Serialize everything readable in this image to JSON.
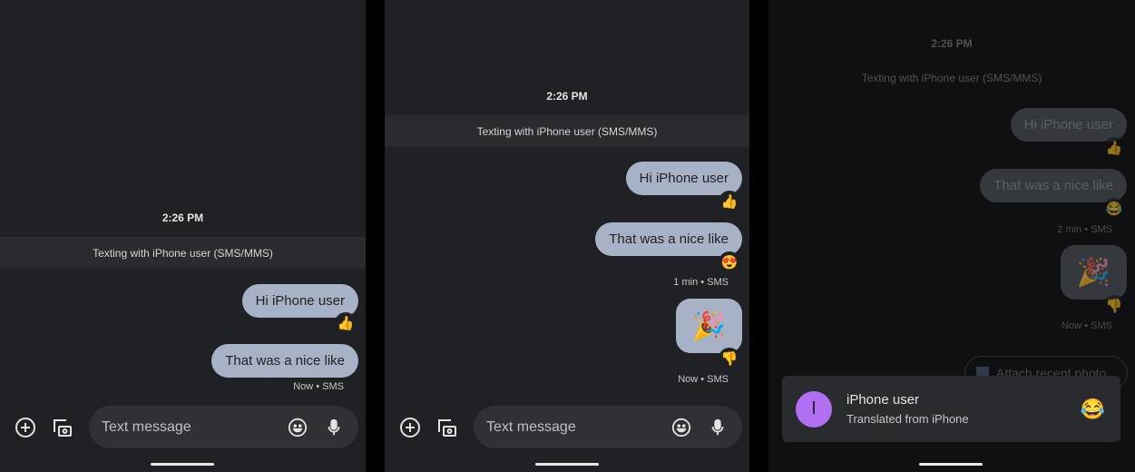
{
  "colors": {
    "background": "#202124",
    "bubble": "#a8b2c6",
    "avatar": "#b06ff0"
  },
  "panels": [
    {
      "time": "2:26 PM",
      "banner": "Texting with iPhone user (SMS/MMS)",
      "messages": [
        {
          "text": "Hi iPhone user",
          "reaction": "👍"
        },
        {
          "text": "That was a nice like"
        }
      ],
      "status": "Now • SMS",
      "composer": {
        "placeholder": "Text message",
        "icons": [
          "plus-circle-icon",
          "gallery-camera-icon",
          "emoji-icon",
          "mic-icon"
        ]
      }
    },
    {
      "time": "2:26 PM",
      "banner": "Texting with iPhone user (SMS/MMS)",
      "messages": [
        {
          "text": "Hi iPhone user",
          "reaction": "👍"
        },
        {
          "text": "That was a nice like",
          "reaction": "😍"
        },
        {
          "emoji": "🎉",
          "reaction": "👎"
        }
      ],
      "status1": "1 min • SMS",
      "status2": "Now • SMS",
      "composer": {
        "placeholder": "Text message"
      }
    },
    {
      "time": "2:26 PM",
      "banner": "Texting with iPhone user (SMS/MMS)",
      "messages": [
        {
          "text": "Hi iPhone user",
          "reaction": "👍"
        },
        {
          "text": "That was a nice like",
          "reaction": "😂"
        },
        {
          "emoji": "🎉",
          "reaction": "👎"
        }
      ],
      "status1": "2 min • SMS",
      "status2": "Now • SMS",
      "chip": "Attach recent photo",
      "notification": {
        "avatar_letter": "I",
        "title": "iPhone user",
        "subtitle": "Translated from iPhone",
        "emoji": "😂"
      }
    }
  ]
}
